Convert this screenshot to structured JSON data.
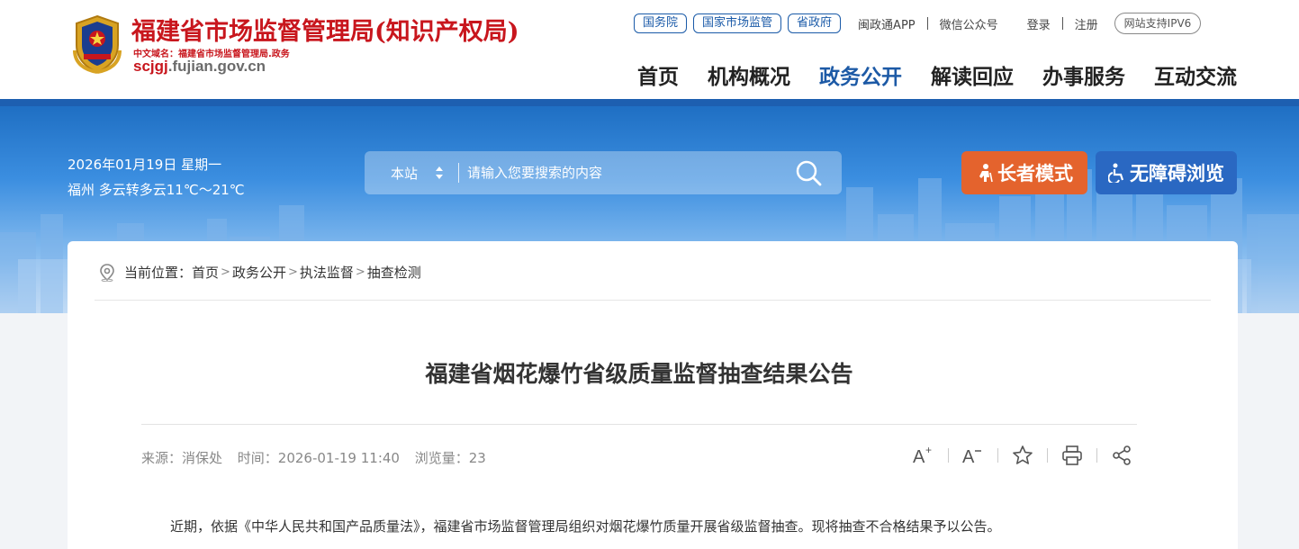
{
  "header": {
    "site_name": "福建省市场监督管理局(知识产权局)",
    "domain_cn": "中文域名：福建省市场监督管理局.政务",
    "url_main": "scjgj",
    "url_rest": ".fujian.gov.cn",
    "pills": [
      "国务院",
      "国家市场监管",
      "省政府"
    ],
    "links": [
      "闽政通APP",
      "微信公众号"
    ],
    "login": "登录",
    "register": "注册",
    "ipv6": "网站支持IPV6",
    "nav": [
      "首页",
      "机构概况",
      "政务公开",
      "解读回应",
      "办事服务",
      "互动交流"
    ],
    "nav_active_index": 2
  },
  "banner": {
    "date": "2026年01月19日 星期一",
    "weather": "福州 多云转多云11℃～21℃",
    "search_scope": "本站",
    "search_placeholder": "请输入您要搜索的内容",
    "elder_mode": "长者模式",
    "accessible": "无障碍浏览"
  },
  "breadcrumb": {
    "prefix": "当前位置：",
    "items": [
      "首页",
      "政务公开",
      "执法监督",
      "抽查检测"
    ]
  },
  "article": {
    "title": "福建省烟花爆竹省级质量监督抽查结果公告",
    "source": "来源：消保处",
    "time": "时间：2026-01-19 11:40",
    "views": "浏览量：23",
    "paragraph": "近期，依据《中华人民共和国产品质量法》，福建省市场监督管理局组织对烟花爆竹质量开展省级监督抽查。现将抽查不合格结果予以公告。"
  },
  "tools": [
    "font-increase-icon",
    "font-decrease-icon",
    "favorite-star-icon",
    "print-icon",
    "share-icon"
  ],
  "colors": {
    "brand_red": "#c8161d",
    "nav_active": "#1d5aa6",
    "elder_button": "#e4632d",
    "accessible_button": "#2a68c2",
    "pill_border": "#1a5aa8"
  }
}
